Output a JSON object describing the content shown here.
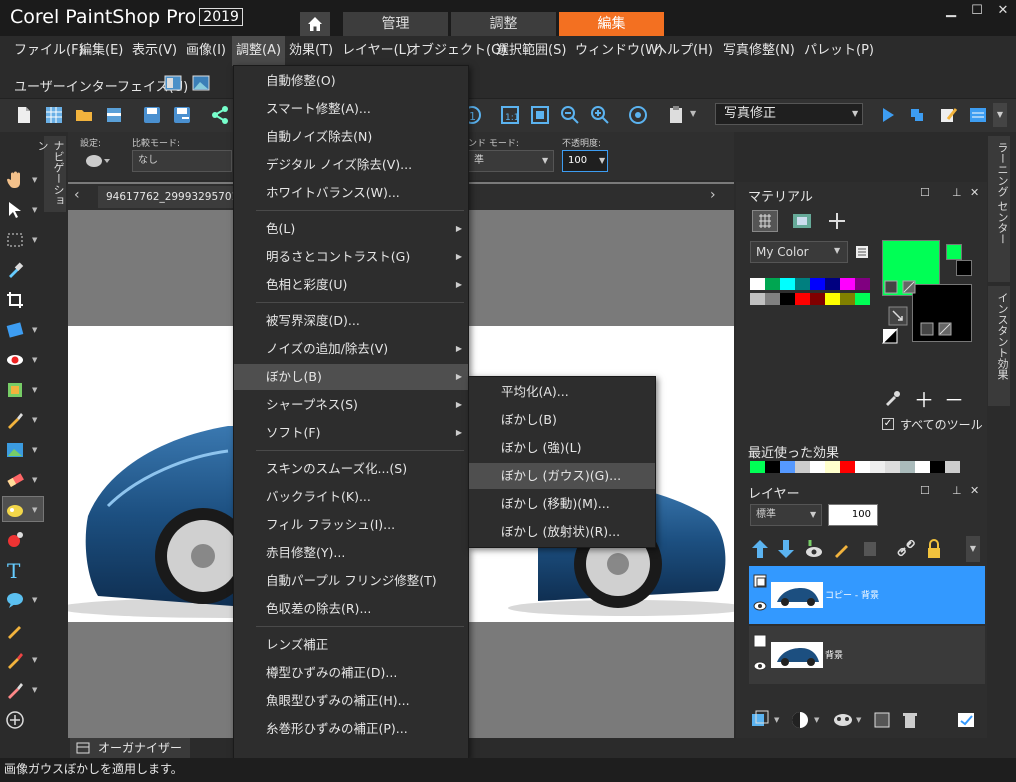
{
  "app": {
    "logo_text": "Corel PaintShop Pro",
    "year": "2019"
  },
  "workspace_tabs": [
    {
      "label": "管理",
      "active": false
    },
    {
      "label": "調整",
      "active": false
    },
    {
      "label": "編集",
      "active": true
    }
  ],
  "menubar": {
    "items": [
      "ファイル(F)",
      "編集(E)",
      "表示(V)",
      "画像(I)",
      "調整(A)",
      "効果(T)",
      "レイヤー(L)",
      "オブジェクト(O)",
      "選択範囲(S)",
      "ウィンドウ(W)",
      "ヘルプ(H)",
      "写真修整(N)",
      "パレット(P)"
    ],
    "open_item": "調整(A)"
  },
  "ui_toolbar": {
    "label": "ユーザーインターフェイス(U)"
  },
  "main_toolbar": {
    "preset": "写真修正"
  },
  "tool_options": {
    "setting_label": "設定:",
    "compare_label": "比較モード:",
    "compare_value": "なし",
    "blend_label": "ンド モード:",
    "blend_value": "準",
    "opacity_label": "不透明度:",
    "opacity_value": "100"
  },
  "navigation_tab": "ナビゲーション",
  "document": {
    "tab_title": "94617762_29993295701"
  },
  "adjust_menu": {
    "items": [
      {
        "label": "自動修整(O)",
        "submenu": false
      },
      {
        "label": "スマート修整(A)...",
        "submenu": false
      },
      {
        "label": "自動ノイズ除去(N)",
        "submenu": false
      },
      {
        "label": "デジタル ノイズ除去(V)...",
        "submenu": false
      },
      {
        "label": "ホワイトバランス(W)...",
        "submenu": false
      },
      {
        "label": "色(L)",
        "submenu": true
      },
      {
        "label": "明るさとコントラスト(G)",
        "submenu": true
      },
      {
        "label": "色相と彩度(U)",
        "submenu": true
      },
      {
        "label": "被写界深度(D)...",
        "submenu": false
      },
      {
        "label": "ノイズの追加/除去(V)",
        "submenu": true
      },
      {
        "label": "ぼかし(B)",
        "submenu": true,
        "highlighted": true
      },
      {
        "label": "シャープネス(S)",
        "submenu": true
      },
      {
        "label": "ソフト(F)",
        "submenu": true
      },
      {
        "label": "スキンのスムーズ化...(S)",
        "submenu": false
      },
      {
        "label": "バックライト(K)...",
        "submenu": false
      },
      {
        "label": "フィル フラッシュ(I)...",
        "submenu": false
      },
      {
        "label": "赤目修整(Y)...",
        "submenu": false
      },
      {
        "label": "自動パープル フリンジ修整(T)",
        "submenu": false
      },
      {
        "label": "色収差の除去(R)...",
        "submenu": false
      },
      {
        "label": "レンズ補正",
        "submenu": false
      },
      {
        "label": "樽型ひずみの補正(D)...",
        "submenu": false
      },
      {
        "label": "魚眼型ひずみの補正(H)...",
        "submenu": false
      },
      {
        "label": "糸巻形ひずみの補正(P)...",
        "submenu": false
      }
    ]
  },
  "blur_submenu": {
    "items": [
      {
        "label": "平均化(A)...",
        "highlighted": false
      },
      {
        "label": "ぼかし(B)",
        "highlighted": false
      },
      {
        "label": "ぼかし (強)(L)",
        "highlighted": false
      },
      {
        "label": "ぼかし (ガウス)(G)...",
        "highlighted": true
      },
      {
        "label": "ぼかし (移動)(M)...",
        "highlighted": false
      },
      {
        "label": "ぼかし (放射状)(R)...",
        "highlighted": false
      }
    ]
  },
  "materials": {
    "title": "マテリアル",
    "color_set": "My Color",
    "foreground": "#00ff55",
    "background": "#000000",
    "swatches_row1": [
      "#ffffff",
      "#00a651",
      "#00ffff",
      "#007f7f",
      "#0000ff",
      "#000080",
      "#ff00ff",
      "#800080"
    ],
    "swatches_row2": [
      "#c0c0c0",
      "#808080",
      "#000000",
      "#ff0000",
      "#800000",
      "#ffff00",
      "#808000",
      "#00ff55"
    ],
    "all_tools_label": "すべてのツール",
    "all_tools_checked": true,
    "recent_effects_label": "最近使った効果",
    "recent_swatches": [
      "#00ff55",
      "#000000",
      "#5599ff",
      "#cccccc",
      "#ffffff",
      "#ffffcc",
      "#ff0000",
      "#ffffff",
      "#eeeeee",
      "#dddddd",
      "#aabbbb",
      "#ffffff",
      "#000000",
      "#cccccc"
    ]
  },
  "layers": {
    "title": "レイヤー",
    "blend_mode": "標準",
    "opacity": "100",
    "items": [
      {
        "name": "コピー - 背景",
        "selected": true
      },
      {
        "name": "背景",
        "selected": false
      }
    ]
  },
  "right_tabs": [
    "ラーニング センター",
    "インスタント効果"
  ],
  "organizer": {
    "label": "オーガナイザー"
  },
  "status": {
    "text": "画像ガウスぼかしを適用します。"
  },
  "colors": {
    "accent": "#f37021",
    "selection": "#3399ff",
    "menu_bg": "#2d2d2d"
  }
}
